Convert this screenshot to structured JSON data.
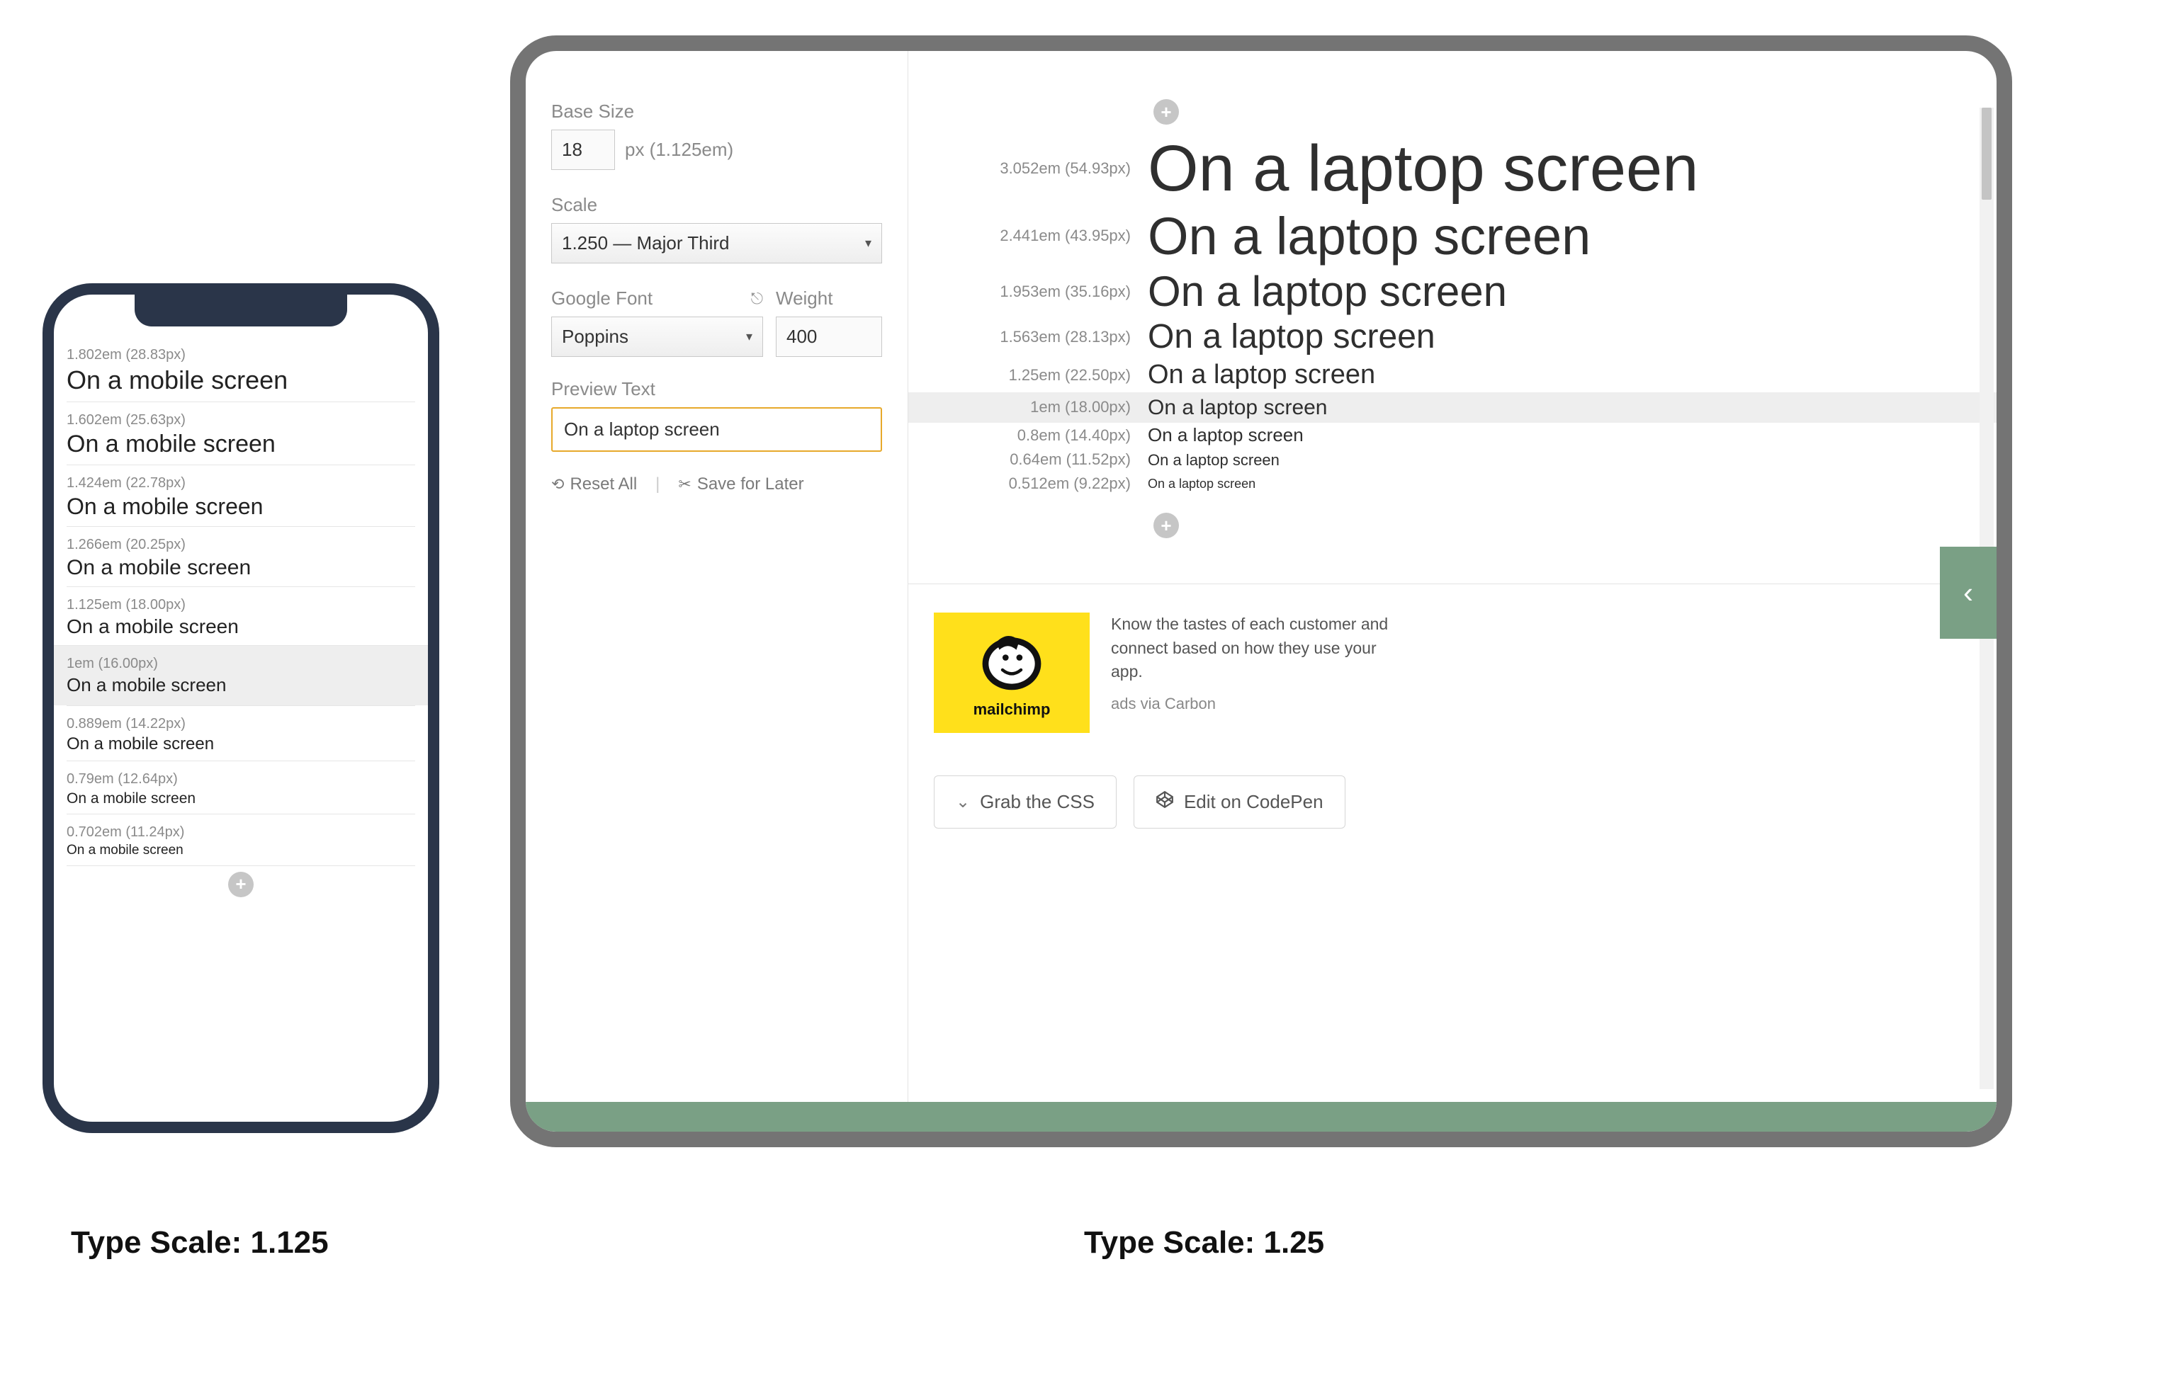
{
  "mobile": {
    "preview_text": "On a mobile screen",
    "rows": [
      {
        "em": "1.802em",
        "px": "28.83px",
        "size": 36
      },
      {
        "em": "1.602em",
        "px": "25.63px",
        "size": 34
      },
      {
        "em": "1.424em",
        "px": "22.78px",
        "size": 32
      },
      {
        "em": "1.266em",
        "px": "20.25px",
        "size": 30
      },
      {
        "em": "1.125em",
        "px": "18.00px",
        "size": 28
      }
    ],
    "base": {
      "em": "1em",
      "px": "16.00px",
      "size": 26
    },
    "rows_below": [
      {
        "em": "0.889em",
        "px": "14.22px",
        "size": 24
      },
      {
        "em": "0.79em",
        "px": "12.64px",
        "size": 21
      },
      {
        "em": "0.702em",
        "px": "11.24px",
        "size": 19
      }
    ]
  },
  "tablet": {
    "labels": {
      "base_size": "Base Size",
      "scale": "Scale",
      "google_font": "Google Font",
      "weight": "Weight",
      "preview_text": "Preview Text"
    },
    "base_size_value": "18",
    "base_size_unit": "px (1.125em)",
    "scale_value": "1.250 — Major Third",
    "google_font_value": "Poppins",
    "weight_value": "400",
    "preview_value": "On a laptop screen",
    "actions": {
      "reset": "Reset All",
      "save": "Save for Later"
    },
    "rows": [
      {
        "em": "3.052em",
        "px": "54.93px",
        "size": 92
      },
      {
        "em": "2.441em",
        "px": "43.95px",
        "size": 74
      },
      {
        "em": "1.953em",
        "px": "35.16px",
        "size": 60
      },
      {
        "em": "1.563em",
        "px": "28.13px",
        "size": 48
      },
      {
        "em": "1.25em",
        "px": "22.50px",
        "size": 38
      }
    ],
    "base": {
      "em": "1em",
      "px": "18.00px",
      "size": 30
    },
    "rows_below": [
      {
        "em": "0.8em",
        "px": "14.40px",
        "size": 26
      },
      {
        "em": "0.64em",
        "px": "11.52px",
        "size": 22
      },
      {
        "em": "0.512em",
        "px": "9.22px",
        "size": 18
      }
    ],
    "ad": {
      "brand": "mailchimp",
      "copy": "Know the tastes of each customer and connect based on how they use your app.",
      "via": "ads via Carbon"
    },
    "buttons": {
      "css": "Grab the CSS",
      "codepen": "Edit on CodePen"
    }
  },
  "captions": {
    "mobile": "Type Scale: 1.125",
    "tablet": "Type Scale: 1.25"
  }
}
